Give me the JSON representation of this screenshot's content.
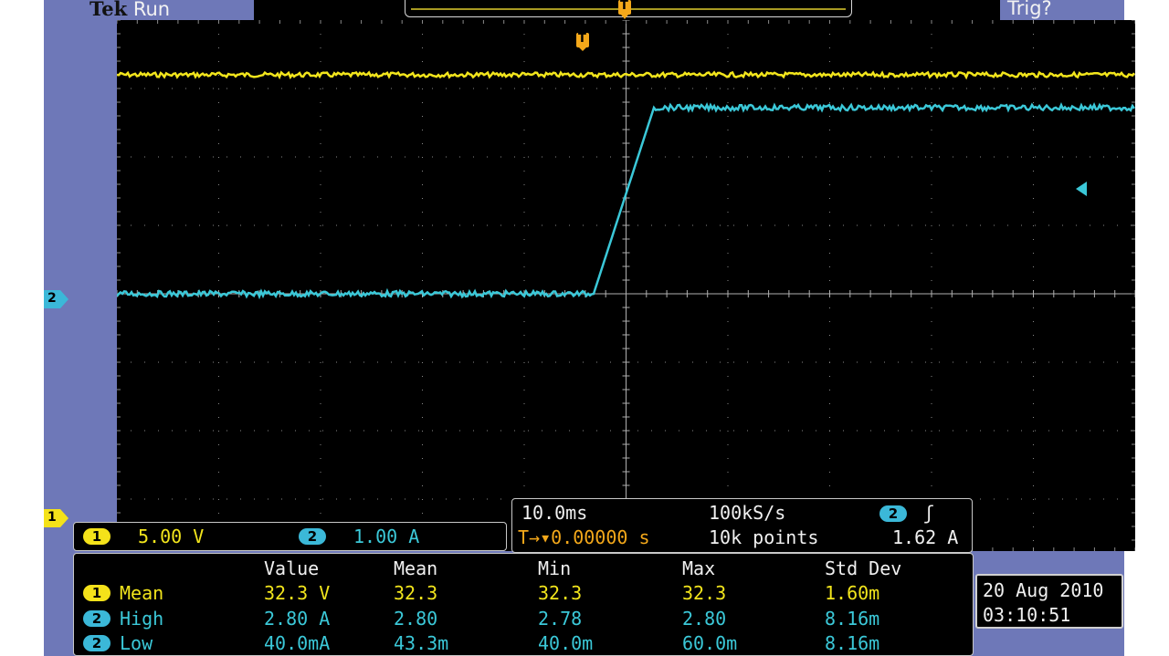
{
  "status": {
    "brand": "Tek",
    "run_state": "Run",
    "trigger_status": "Trig?"
  },
  "markers": {
    "trigger_top": "T",
    "trigger_screen": "T",
    "ch2_ground": "2",
    "ch1_ground": "1"
  },
  "channel_settings": {
    "ch1": {
      "badge": "1",
      "scale": "5.00 V",
      "color": "#f2e51c"
    },
    "ch2": {
      "badge": "2",
      "scale": "1.00 A",
      "color": "#3bc8d8"
    }
  },
  "horizontal": {
    "time_div": "10.0ms",
    "sample_rate": "100kS/s",
    "trig_badge": "2",
    "trig_slope": "ʃ",
    "trigger_position": "T→▾0.00000 s",
    "record_length": "10k points",
    "trigger_level": "1.62 A"
  },
  "measurements": {
    "headers": [
      "Value",
      "Mean",
      "Min",
      "Max",
      "Std Dev"
    ],
    "rows": [
      {
        "badge": "1",
        "label": "Mean",
        "value": "32.3 V",
        "mean": "32.3",
        "min": "32.3",
        "max": "32.3",
        "std": "1.60m",
        "color": "#f2e51c"
      },
      {
        "badge": "2",
        "label": "High",
        "value": "2.80 A",
        "mean": "2.80",
        "min": "2.78",
        "max": "2.80",
        "std": "8.16m",
        "color": "#3bc8d8"
      },
      {
        "badge": "2",
        "label": "Low",
        "value": "40.0mA",
        "mean": "43.3m",
        "min": "40.0m",
        "max": "60.0m",
        "std": "8.16m",
        "color": "#3bc8d8"
      }
    ]
  },
  "datetime": {
    "date": "20 Aug 2010",
    "time": "03:10:51"
  },
  "waveforms": {
    "ch1_trace_color": "#f2e51c",
    "ch2_trace_color": "#3bc8d8"
  }
}
